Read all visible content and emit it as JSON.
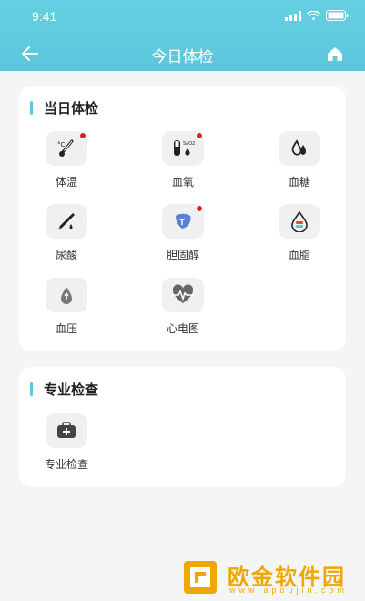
{
  "status": {
    "time": "9:41"
  },
  "nav": {
    "title": "今日体检"
  },
  "sections": [
    {
      "title": "当日体检",
      "items": [
        {
          "label": "体温",
          "icon": "thermometer-icon",
          "badge": true
        },
        {
          "label": "血氧",
          "icon": "blood-oxygen-icon",
          "badge": true
        },
        {
          "label": "血糖",
          "icon": "blood-sugar-icon",
          "badge": false
        },
        {
          "label": "尿酸",
          "icon": "uric-acid-icon",
          "badge": false
        },
        {
          "label": "胆固醇",
          "icon": "cholesterol-icon",
          "badge": true
        },
        {
          "label": "血脂",
          "icon": "blood-lipid-icon",
          "badge": false
        },
        {
          "label": "血压",
          "icon": "blood-pressure-icon",
          "badge": false
        },
        {
          "label": "心电图",
          "icon": "ecg-icon",
          "badge": false
        }
      ]
    },
    {
      "title": "专业检查",
      "items": [
        {
          "label": "专业检查",
          "icon": "medical-kit-icon",
          "badge": false
        }
      ]
    }
  ],
  "watermark": {
    "text": "欧金软件园",
    "url": "www.apoujin.com"
  },
  "colors": {
    "accent": "#5cc8dd",
    "badge": "#e02020",
    "watermark": "#f0a800"
  }
}
